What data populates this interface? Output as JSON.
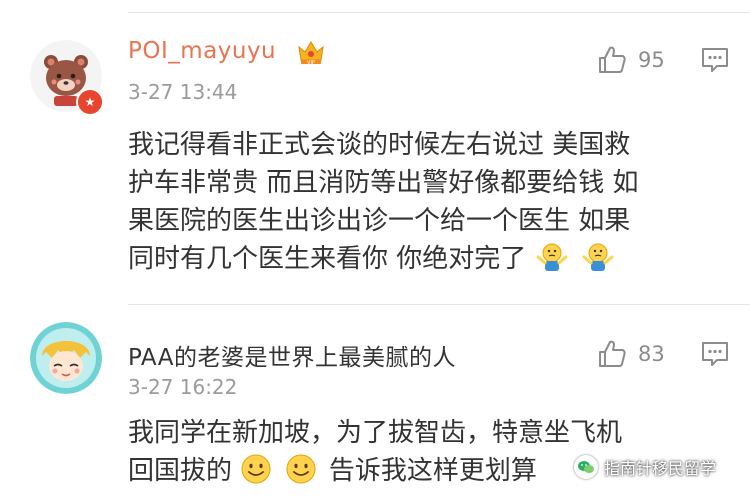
{
  "comments": [
    {
      "username": "POI_mayuyu",
      "timestamp": "3-27 13:44",
      "likes": "95",
      "text_lines": [
        "我记得看非正式会谈的时候左右说过 美国救",
        "护车非常贵 而且消防等出警好像都要给钱 如",
        "果医院的医生出诊出诊一个给一个医生 如果",
        "同时有几个医生来看你 你绝对完了"
      ],
      "avatar_icon": "bear-avatar-icon",
      "badge_icon": "verified-badge-icon",
      "vip_icon": "vip-crown-icon",
      "emojis": [
        "shrug-emoji-icon",
        "shrug-emoji-icon"
      ]
    },
    {
      "username": "PAA的老婆是世界上最美腻的人",
      "timestamp": "3-27 16:22",
      "likes": "83",
      "text_lines": [
        "我同学在新加坡，为了拔智齿，特意坐飞机",
        "回国拔的",
        "告诉我这样更划算"
      ],
      "avatar_icon": "anime-girl-avatar-icon",
      "emojis": [
        "smile-emoji-icon",
        "smile-emoji-icon"
      ]
    }
  ],
  "watermark": {
    "text": "指南针移民留学",
    "icon": "wechat-logo-icon"
  },
  "colors": {
    "username_highlight": "#eb7350",
    "text": "#333333",
    "meta": "#9b9b9b",
    "divider": "#e6e6e6"
  }
}
